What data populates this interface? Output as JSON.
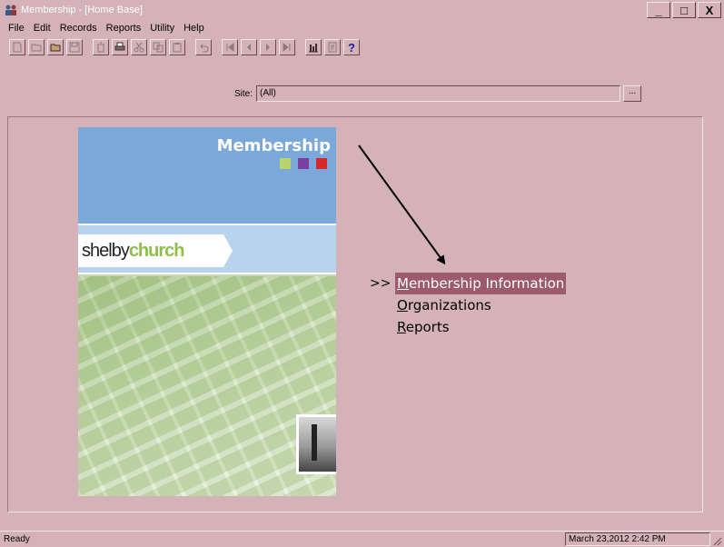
{
  "window": {
    "title": "Membership - [Home Base]",
    "minimize_label": "_",
    "maximize_label": "□",
    "close_label": "X"
  },
  "menubar": {
    "items": [
      "File",
      "Edit",
      "Records",
      "Reports",
      "Utility",
      "Help"
    ]
  },
  "toolbar": {
    "buttons": [
      {
        "icon": "new-document-icon",
        "enabled": false
      },
      {
        "icon": "open-folder-icon",
        "enabled": false
      },
      {
        "icon": "open-record-icon",
        "enabled": true
      },
      {
        "icon": "save-icon",
        "enabled": false
      },
      {
        "icon": "delete-icon",
        "enabled": false
      },
      {
        "icon": "print-icon",
        "enabled": true
      },
      {
        "icon": "cut-icon",
        "enabled": false
      },
      {
        "icon": "copy-icon",
        "enabled": false
      },
      {
        "icon": "paste-icon",
        "enabled": false
      },
      {
        "icon": "undo-icon",
        "enabled": false
      },
      {
        "icon": "first-record-icon",
        "enabled": false
      },
      {
        "icon": "previous-record-icon",
        "enabled": false
      },
      {
        "icon": "next-record-icon",
        "enabled": false
      },
      {
        "icon": "last-record-icon",
        "enabled": false
      },
      {
        "icon": "chart-icon",
        "enabled": true
      },
      {
        "icon": "report-icon",
        "enabled": false
      },
      {
        "icon": "help-icon",
        "enabled": true
      }
    ]
  },
  "site": {
    "label": "Site:",
    "value": "(All)",
    "browse_label": "..."
  },
  "brand": {
    "title": "Membership",
    "logo_part1": "shelby",
    "logo_part2": "church",
    "square_colors": [
      "#b9d46a",
      "#7b3fa0",
      "#d42a2a"
    ]
  },
  "links": {
    "marker": ">>",
    "items": [
      {
        "access": "M",
        "rest": "embership Information",
        "selected": true
      },
      {
        "access": "O",
        "rest": "rganizations",
        "selected": false
      },
      {
        "access": "R",
        "rest": "eports",
        "selected": false
      }
    ]
  },
  "status": {
    "left": "Ready",
    "right": "March 23,2012 2:42 PM"
  }
}
